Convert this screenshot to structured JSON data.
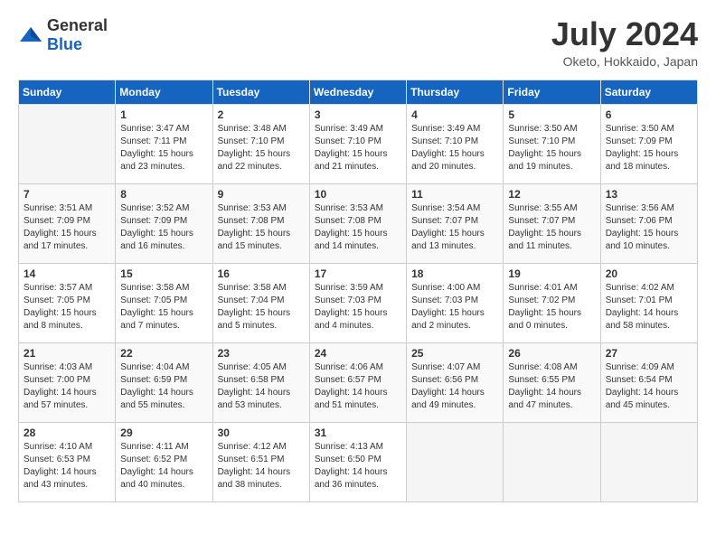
{
  "header": {
    "logo_general": "General",
    "logo_blue": "Blue",
    "month": "July 2024",
    "location": "Oketo, Hokkaido, Japan"
  },
  "days_of_week": [
    "Sunday",
    "Monday",
    "Tuesday",
    "Wednesday",
    "Thursday",
    "Friday",
    "Saturday"
  ],
  "weeks": [
    [
      null,
      {
        "day": 1,
        "sunrise": "Sunrise: 3:47 AM",
        "sunset": "Sunset: 7:11 PM",
        "daylight": "Daylight: 15 hours and 23 minutes."
      },
      {
        "day": 2,
        "sunrise": "Sunrise: 3:48 AM",
        "sunset": "Sunset: 7:10 PM",
        "daylight": "Daylight: 15 hours and 22 minutes."
      },
      {
        "day": 3,
        "sunrise": "Sunrise: 3:49 AM",
        "sunset": "Sunset: 7:10 PM",
        "daylight": "Daylight: 15 hours and 21 minutes."
      },
      {
        "day": 4,
        "sunrise": "Sunrise: 3:49 AM",
        "sunset": "Sunset: 7:10 PM",
        "daylight": "Daylight: 15 hours and 20 minutes."
      },
      {
        "day": 5,
        "sunrise": "Sunrise: 3:50 AM",
        "sunset": "Sunset: 7:10 PM",
        "daylight": "Daylight: 15 hours and 19 minutes."
      },
      {
        "day": 6,
        "sunrise": "Sunrise: 3:50 AM",
        "sunset": "Sunset: 7:09 PM",
        "daylight": "Daylight: 15 hours and 18 minutes."
      }
    ],
    [
      {
        "day": 7,
        "sunrise": "Sunrise: 3:51 AM",
        "sunset": "Sunset: 7:09 PM",
        "daylight": "Daylight: 15 hours and 17 minutes."
      },
      {
        "day": 8,
        "sunrise": "Sunrise: 3:52 AM",
        "sunset": "Sunset: 7:09 PM",
        "daylight": "Daylight: 15 hours and 16 minutes."
      },
      {
        "day": 9,
        "sunrise": "Sunrise: 3:53 AM",
        "sunset": "Sunset: 7:08 PM",
        "daylight": "Daylight: 15 hours and 15 minutes."
      },
      {
        "day": 10,
        "sunrise": "Sunrise: 3:53 AM",
        "sunset": "Sunset: 7:08 PM",
        "daylight": "Daylight: 15 hours and 14 minutes."
      },
      {
        "day": 11,
        "sunrise": "Sunrise: 3:54 AM",
        "sunset": "Sunset: 7:07 PM",
        "daylight": "Daylight: 15 hours and 13 minutes."
      },
      {
        "day": 12,
        "sunrise": "Sunrise: 3:55 AM",
        "sunset": "Sunset: 7:07 PM",
        "daylight": "Daylight: 15 hours and 11 minutes."
      },
      {
        "day": 13,
        "sunrise": "Sunrise: 3:56 AM",
        "sunset": "Sunset: 7:06 PM",
        "daylight": "Daylight: 15 hours and 10 minutes."
      }
    ],
    [
      {
        "day": 14,
        "sunrise": "Sunrise: 3:57 AM",
        "sunset": "Sunset: 7:05 PM",
        "daylight": "Daylight: 15 hours and 8 minutes."
      },
      {
        "day": 15,
        "sunrise": "Sunrise: 3:58 AM",
        "sunset": "Sunset: 7:05 PM",
        "daylight": "Daylight: 15 hours and 7 minutes."
      },
      {
        "day": 16,
        "sunrise": "Sunrise: 3:58 AM",
        "sunset": "Sunset: 7:04 PM",
        "daylight": "Daylight: 15 hours and 5 minutes."
      },
      {
        "day": 17,
        "sunrise": "Sunrise: 3:59 AM",
        "sunset": "Sunset: 7:03 PM",
        "daylight": "Daylight: 15 hours and 4 minutes."
      },
      {
        "day": 18,
        "sunrise": "Sunrise: 4:00 AM",
        "sunset": "Sunset: 7:03 PM",
        "daylight": "Daylight: 15 hours and 2 minutes."
      },
      {
        "day": 19,
        "sunrise": "Sunrise: 4:01 AM",
        "sunset": "Sunset: 7:02 PM",
        "daylight": "Daylight: 15 hours and 0 minutes."
      },
      {
        "day": 20,
        "sunrise": "Sunrise: 4:02 AM",
        "sunset": "Sunset: 7:01 PM",
        "daylight": "Daylight: 14 hours and 58 minutes."
      }
    ],
    [
      {
        "day": 21,
        "sunrise": "Sunrise: 4:03 AM",
        "sunset": "Sunset: 7:00 PM",
        "daylight": "Daylight: 14 hours and 57 minutes."
      },
      {
        "day": 22,
        "sunrise": "Sunrise: 4:04 AM",
        "sunset": "Sunset: 6:59 PM",
        "daylight": "Daylight: 14 hours and 55 minutes."
      },
      {
        "day": 23,
        "sunrise": "Sunrise: 4:05 AM",
        "sunset": "Sunset: 6:58 PM",
        "daylight": "Daylight: 14 hours and 53 minutes."
      },
      {
        "day": 24,
        "sunrise": "Sunrise: 4:06 AM",
        "sunset": "Sunset: 6:57 PM",
        "daylight": "Daylight: 14 hours and 51 minutes."
      },
      {
        "day": 25,
        "sunrise": "Sunrise: 4:07 AM",
        "sunset": "Sunset: 6:56 PM",
        "daylight": "Daylight: 14 hours and 49 minutes."
      },
      {
        "day": 26,
        "sunrise": "Sunrise: 4:08 AM",
        "sunset": "Sunset: 6:55 PM",
        "daylight": "Daylight: 14 hours and 47 minutes."
      },
      {
        "day": 27,
        "sunrise": "Sunrise: 4:09 AM",
        "sunset": "Sunset: 6:54 PM",
        "daylight": "Daylight: 14 hours and 45 minutes."
      }
    ],
    [
      {
        "day": 28,
        "sunrise": "Sunrise: 4:10 AM",
        "sunset": "Sunset: 6:53 PM",
        "daylight": "Daylight: 14 hours and 43 minutes."
      },
      {
        "day": 29,
        "sunrise": "Sunrise: 4:11 AM",
        "sunset": "Sunset: 6:52 PM",
        "daylight": "Daylight: 14 hours and 40 minutes."
      },
      {
        "day": 30,
        "sunrise": "Sunrise: 4:12 AM",
        "sunset": "Sunset: 6:51 PM",
        "daylight": "Daylight: 14 hours and 38 minutes."
      },
      {
        "day": 31,
        "sunrise": "Sunrise: 4:13 AM",
        "sunset": "Sunset: 6:50 PM",
        "daylight": "Daylight: 14 hours and 36 minutes."
      },
      null,
      null,
      null
    ]
  ]
}
